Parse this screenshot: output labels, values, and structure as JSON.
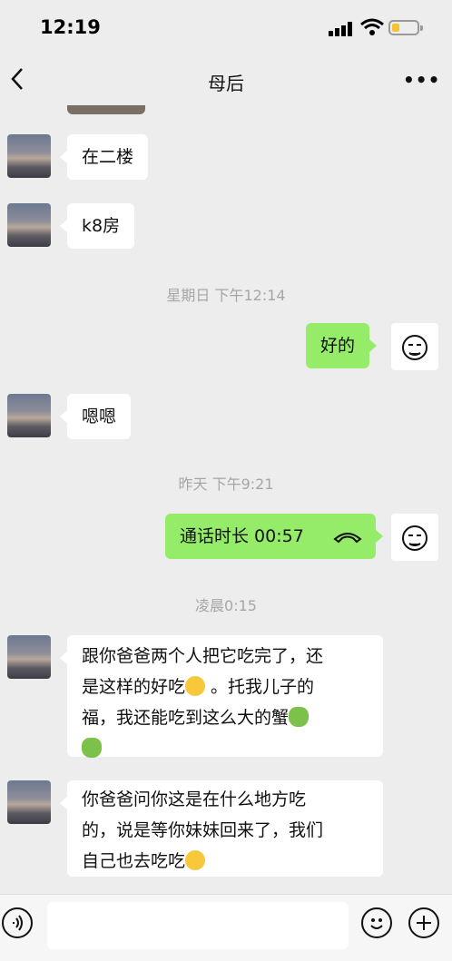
{
  "status_bar": {
    "time": "12:19"
  },
  "nav": {
    "title": "母后",
    "more_label": "•••"
  },
  "messages": [
    {
      "side": "left",
      "text": "在二楼"
    },
    {
      "side": "left",
      "text": "k8房"
    },
    {
      "side": "center",
      "text": "星期日 下午12:14"
    },
    {
      "side": "right",
      "text": "好的"
    },
    {
      "side": "left",
      "text": "嗯嗯"
    },
    {
      "side": "center",
      "text": "昨天 下午9:21"
    },
    {
      "side": "right",
      "type": "call",
      "text": "通话时长 00:57"
    },
    {
      "side": "center",
      "text": "凌晨0:15"
    },
    {
      "side": "left",
      "lines": [
        "跟你爸爸两个人把它吃完了，还",
        "是这样的好吃",
        " 。托我儿子的",
        "福，我还能吃到这么大的蟹"
      ]
    },
    {
      "side": "left",
      "lines": [
        "你爸爸问你这是在什么地方吃",
        "的，说是等你妹妹回来了，我们",
        "自己也去吃吃"
      ]
    }
  ],
  "icons": {
    "voice": "voice-icon",
    "emoji": "emoji-icon",
    "plus": "plus-icon",
    "hangup": "phone-hangup-icon"
  },
  "colors": {
    "sent_bubble": "#95ec69",
    "received_bubble": "#ffffff",
    "background": "#ededed"
  }
}
